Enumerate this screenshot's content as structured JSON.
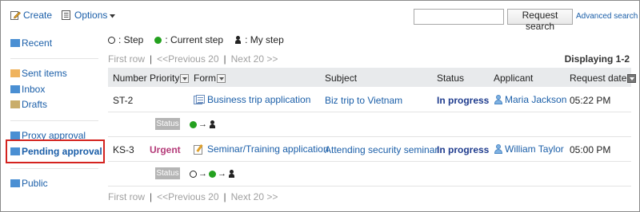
{
  "toolbar": {
    "create": "Create",
    "options": "Options"
  },
  "search": {
    "placeholder": "",
    "button": "Request search",
    "advanced": "Advanced search"
  },
  "sidebar": {
    "items": [
      {
        "label": "Recent",
        "icon": "folder-icon",
        "color": "#4a8fd3"
      },
      {
        "label": "Sent items",
        "icon": "folder-icon",
        "color": "#efb35e"
      },
      {
        "label": "Inbox",
        "icon": "folder-icon",
        "color": "#4a8fd3"
      },
      {
        "label": "Drafts",
        "icon": "folder-icon",
        "color": "#c9ad6a"
      },
      {
        "label": "Proxy approval",
        "icon": "folder-icon",
        "color": "#4a8fd3"
      },
      {
        "label": "Pending approval",
        "icon": "folder-icon",
        "color": "#4a8fd3",
        "selected": true
      },
      {
        "label": "Public",
        "icon": "folder-icon",
        "color": "#4a8fd3"
      }
    ]
  },
  "legend": {
    "step": ": Step",
    "current": ": Current step",
    "mine": ": My step"
  },
  "pager": {
    "first": "First row",
    "previous": "<<Previous 20",
    "next": "Next 20 >>",
    "separator": "|",
    "displaying": "Displaying 1-2"
  },
  "table": {
    "headers": [
      "Number",
      "Priority",
      "Form",
      "Subject",
      "Status",
      "Applicant",
      "Request date"
    ],
    "rows": [
      {
        "number": "ST-2",
        "priority": "",
        "form": "Business trip application",
        "subject": "Biz trip to Vietnam",
        "status": "In progress",
        "applicant": "Maria Jackson",
        "date": "05:22 PM",
        "status_tag": "Status"
      },
      {
        "number": "KS-3",
        "priority": "Urgent",
        "form": "Seminar/Training application",
        "subject": "Attending security seminar",
        "status": "In progress",
        "applicant": "William Taylor",
        "date": "05:00 PM",
        "status_tag": "Status"
      }
    ]
  },
  "arrow": "→",
  "colors": {
    "link": "#1a5ea8",
    "urgent": "#b43a78",
    "in_progress": "#1f3c8e",
    "current_step": "#24a11f",
    "highlight": "#d4231f"
  }
}
